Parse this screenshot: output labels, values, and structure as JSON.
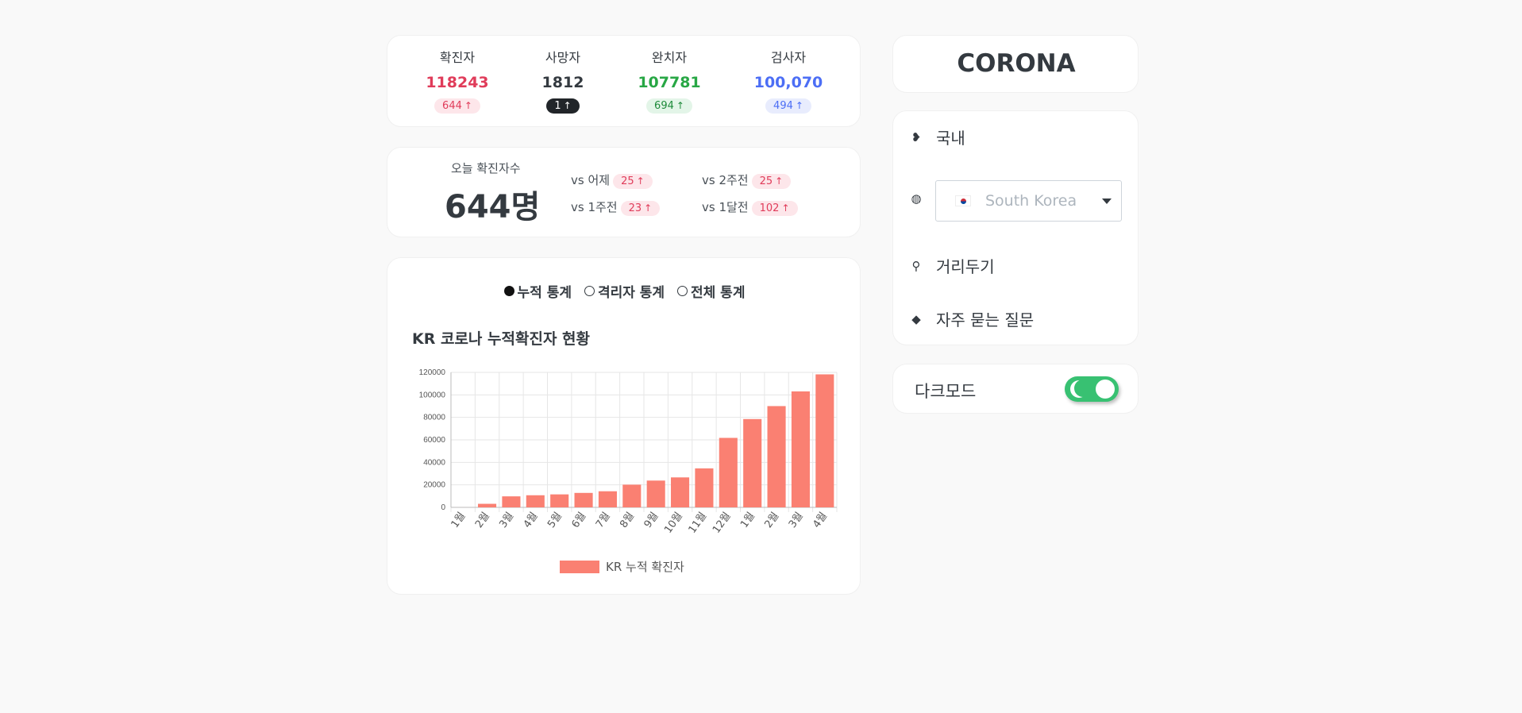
{
  "stats": [
    {
      "label": "확진자",
      "value": "118243",
      "delta": "644",
      "color": "#e03c5a",
      "badge_bg": "#fde6ea",
      "badge_fg": "#e03c5a"
    },
    {
      "label": "사망자",
      "value": "1812",
      "delta": "1",
      "color": "#343a40",
      "badge_bg": "#212529",
      "badge_fg": "#ffffff"
    },
    {
      "label": "완치자",
      "value": "107781",
      "delta": "694",
      "color": "#28a745",
      "badge_bg": "#e3f5e8",
      "badge_fg": "#1e8a3a"
    },
    {
      "label": "검사자",
      "value": "100,070",
      "delta": "494",
      "color": "#4c6ef5",
      "badge_bg": "#e8ecfd",
      "badge_fg": "#4c6ef5"
    }
  ],
  "today": {
    "label": "오늘 확진자수",
    "value": "644명",
    "comparisons": [
      {
        "label": "vs 어제",
        "delta": "25"
      },
      {
        "label": "vs 2주전",
        "delta": "25"
      },
      {
        "label": "vs 1주전",
        "delta": "23"
      },
      {
        "label": "vs 1달전",
        "delta": "102"
      }
    ]
  },
  "radios": [
    {
      "label": "누적 통계",
      "selected": true
    },
    {
      "label": "격리자 통계",
      "selected": false
    },
    {
      "label": "전체 통계",
      "selected": false
    }
  ],
  "chart_title": "KR 코로나 누적확진자 현황",
  "chart_data": {
    "type": "bar",
    "title": "KR 코로나 누적확진자 현황",
    "categories": [
      "1월",
      "2월",
      "3월",
      "4월",
      "5월",
      "6월",
      "7월",
      "8월",
      "9월",
      "10월",
      "11월",
      "12월",
      "1월",
      "2월",
      "3월",
      "4월"
    ],
    "series": [
      {
        "name": "KR 누적 확진자",
        "color": "#fa8072",
        "values": [
          11,
          3150,
          9786,
          10765,
          11541,
          12850,
          14305,
          20182,
          23812,
          26635,
          34652,
          61769,
          78508,
          90029,
          103088,
          118243
        ]
      }
    ],
    "ylim": [
      0,
      120000
    ],
    "yticks": [
      0,
      20000,
      40000,
      60000,
      80000,
      100000,
      120000
    ],
    "grid": true,
    "legend": "bottom"
  },
  "brand": "CORONA",
  "menu": {
    "domestic": "국내",
    "country": "South Korea",
    "distancing": "거리두기",
    "faq": "자주 묻는 질문"
  },
  "dark_mode": {
    "label": "다크모드",
    "on": true,
    "color": "#38c172"
  }
}
